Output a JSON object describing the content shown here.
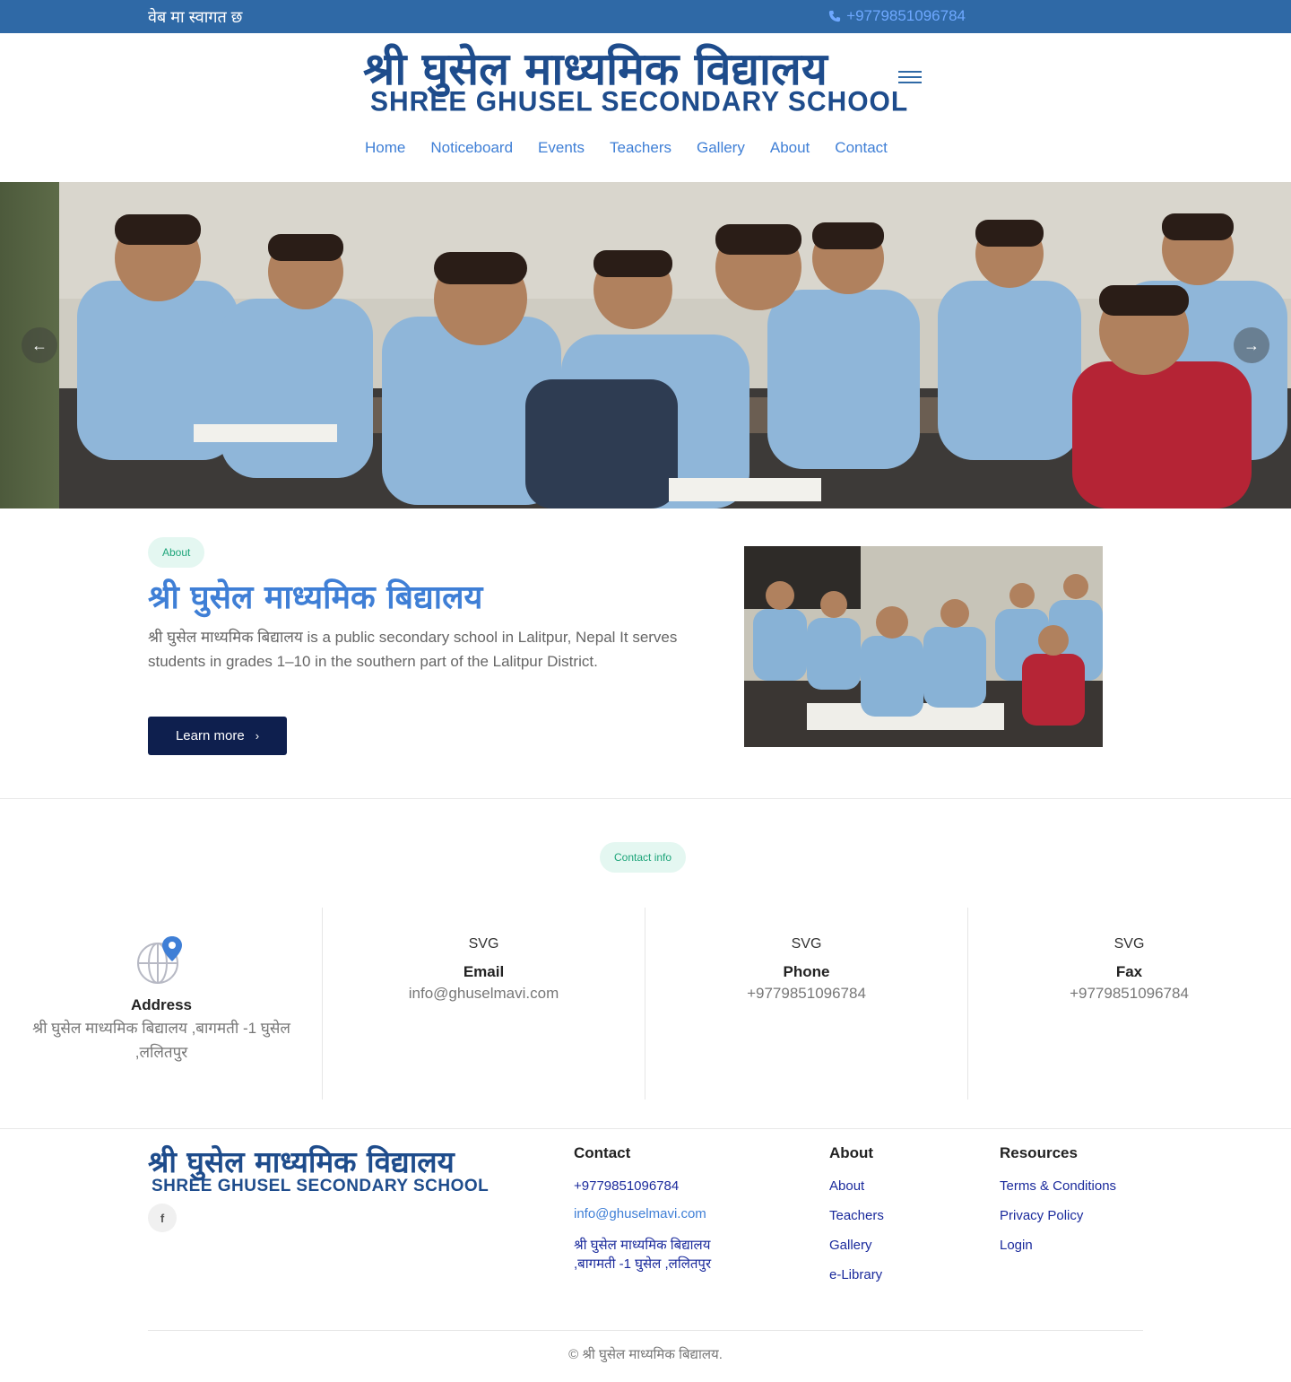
{
  "topbar": {
    "welcome": "वेब मा स्वागत छ",
    "phone": "+9779851096784"
  },
  "logo": {
    "line1": "श्री घुसेल माध्यमिक विद्यालय",
    "line2": "SHREE GHUSEL SECONDARY SCHOOL"
  },
  "nav": {
    "items": [
      "Home",
      "Noticeboard",
      "Events",
      "Teachers",
      "Gallery",
      "About",
      "Contact"
    ]
  },
  "hero": {
    "prev_icon": "arrow-left-icon",
    "next_icon": "arrow-right-icon"
  },
  "about": {
    "pill": "About",
    "title": "श्री घुसेल माध्यमिक बिद्यालय",
    "text": "श्री घुसेल माध्यमिक बिद्यालय is a public secondary school in Lalitpur, Nepal It serves students in grades 1–10 in the southern part of the Lalitpur District.",
    "button": "Learn more"
  },
  "contact_info": {
    "pill": "Contact info",
    "columns": [
      {
        "title": "Address",
        "value": "श्री घुसेल माध्यमिक बिद्यालय ,बागमती -1 घुसेल ,ललितपुर",
        "icon": "globe-location-icon"
      },
      {
        "title": "Email",
        "value": "info@ghuselmavi.com",
        "icon_alt": "SVG"
      },
      {
        "title": "Phone",
        "value": "+9779851096784",
        "icon_alt": "SVG"
      },
      {
        "title": "Fax",
        "value": "+9779851096784",
        "icon_alt": "SVG"
      }
    ]
  },
  "footer": {
    "logo_line1": "श्री घुसेल माध्यमिक विद्यालय",
    "logo_line2": "SHREE GHUSEL SECONDARY SCHOOL",
    "facebook": "f",
    "contact": {
      "title": "Contact",
      "phone": "+9779851096784",
      "email": "info@ghuselmavi.com",
      "address": "श्री घुसेल माध्यमिक बिद्यालय ,बागमती -1 घुसेल ,ललितपुर"
    },
    "about": {
      "title": "About",
      "links": [
        "About",
        "Teachers",
        "Gallery",
        "e-Library"
      ]
    },
    "resources": {
      "title": "Resources",
      "links": [
        "Terms & Conditions",
        "Privacy Policy",
        "Login"
      ]
    },
    "copyright": "© श्री घुसेल माध्यमिक बिद्यालय."
  },
  "colors": {
    "topbar": "#2f69a6",
    "brand_blue": "#1e4c8c",
    "link_blue": "#3f7fd6",
    "button_navy": "#0e1f4e",
    "pill_bg": "#e4f7f1",
    "pill_text": "#1ea57a"
  }
}
